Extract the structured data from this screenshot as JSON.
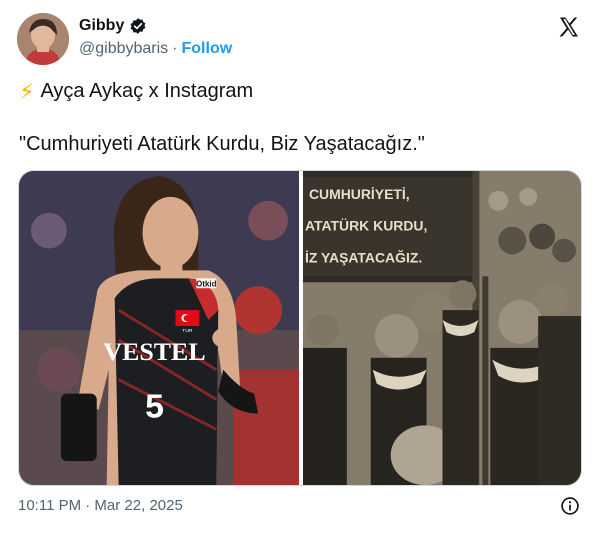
{
  "author": {
    "display_name": "Gibby",
    "handle": "@gibbybaris",
    "separator": "·",
    "follow_label": "Follow",
    "verified": true,
    "avatar_icon": "profile-photo"
  },
  "tweet": {
    "line1_icon": "lightning-bolt-emoji",
    "line1_text": "Ayça Aykaç x Instagram",
    "line2_text": "\"Cumhuriyeti Atatürk Kurdu, Biz Yaşatacağız.\"",
    "timestamp": "10:11 PM · Mar 22, 2025"
  },
  "media": {
    "left_photo": {
      "jersey_brand": "VESTEL",
      "jersey_number": "5",
      "sleeve_patch": "Otkid",
      "flag_label": "TUR"
    },
    "right_photo": {
      "banner_line1": "CUMHURİYETİ,",
      "banner_line2": "ATATÜRK  KURDU,",
      "banner_line3": "İZ  YAŞATACAĞIZ."
    }
  },
  "colors": {
    "accent": "#1d9bf0",
    "text": "#0f1419",
    "secondary": "#536471",
    "bolt": "#f7b500"
  },
  "icons": [
    "verified-badge-icon",
    "x-logo-icon",
    "info-icon"
  ]
}
